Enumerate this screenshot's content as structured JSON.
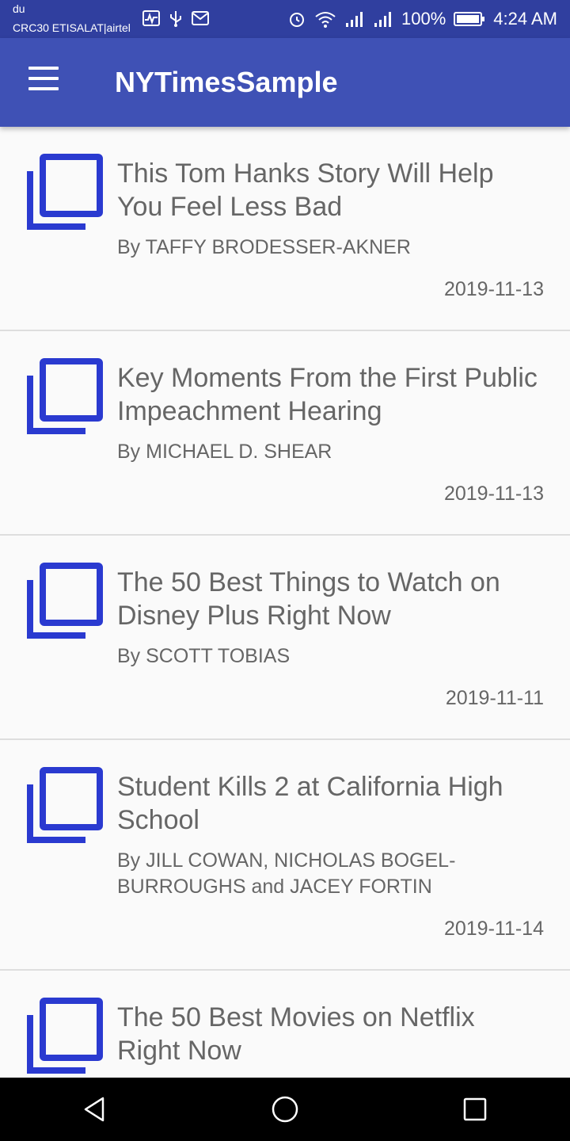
{
  "status_bar": {
    "carrier_line1": "du",
    "carrier_line2": "CRC30 ETISALAT|airtel",
    "battery": "100%",
    "time": "4:24 AM"
  },
  "app_bar": {
    "title": "NYTimesSample"
  },
  "colors": {
    "status_bar": "#303f9f",
    "app_bar": "#3f51b5",
    "icon": "#2a3ad0",
    "text": "#666666",
    "background": "#fafafa"
  },
  "articles": [
    {
      "title": "This Tom Hanks Story Will Help You Feel Less Bad",
      "byline": "By TAFFY BRODESSER-AKNER",
      "date": "2019-11-13",
      "icon": "library-books-icon"
    },
    {
      "title": "Key Moments From the First Public Impeachment Hearing",
      "byline": "By MICHAEL D. SHEAR",
      "date": "2019-11-13",
      "icon": "library-books-icon"
    },
    {
      "title": "The 50 Best Things to Watch on Disney Plus Right Now",
      "byline": "By SCOTT TOBIAS",
      "date": "2019-11-11",
      "icon": "library-books-icon"
    },
    {
      "title": "Student Kills 2 at California High School",
      "byline": "By JILL COWAN, NICHOLAS BOGEL-BURROUGHS and JACEY FORTIN",
      "date": "2019-11-14",
      "icon": "library-books-icon"
    },
    {
      "title": "The 50 Best Movies on Netflix Right Now",
      "byline": "",
      "date": "",
      "icon": "library-books-icon"
    }
  ]
}
